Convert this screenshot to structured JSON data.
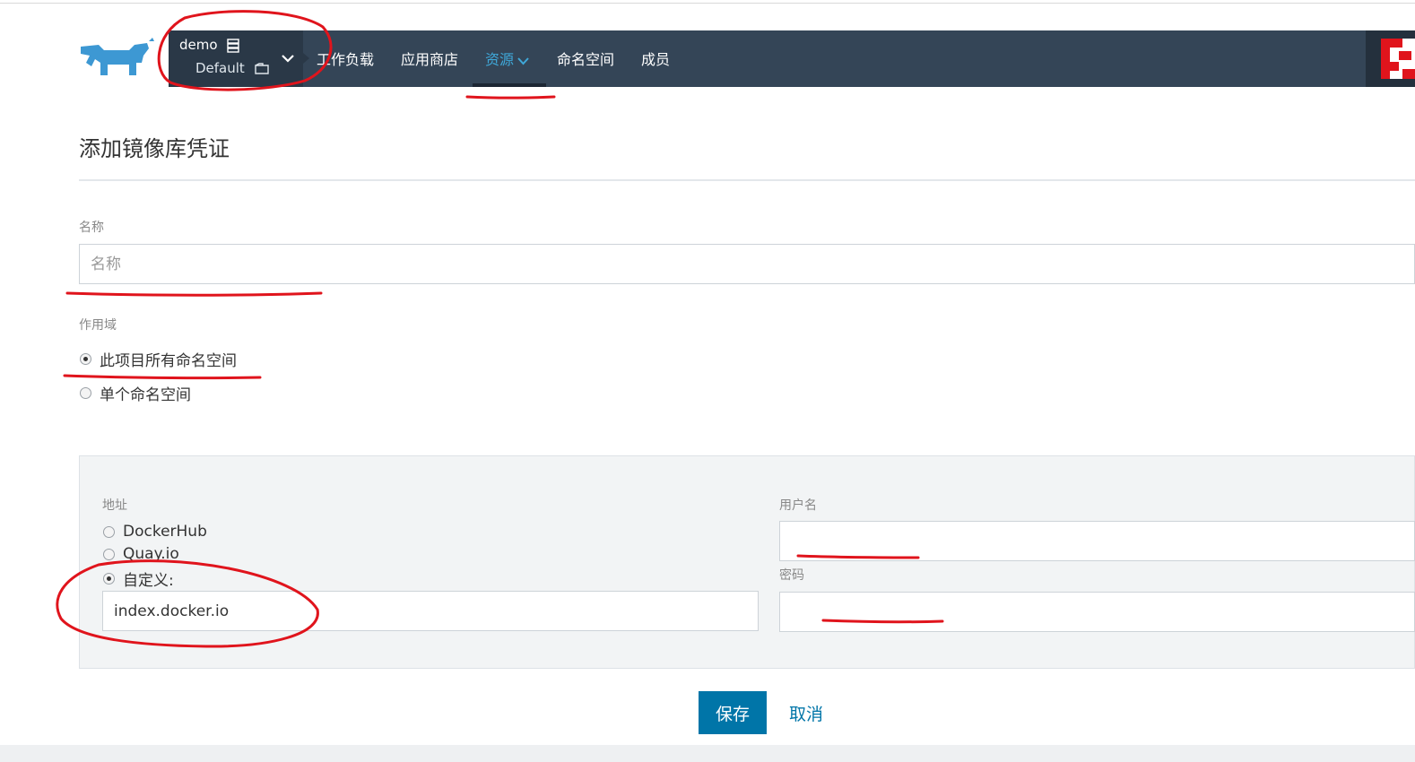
{
  "header": {
    "environment": {
      "cluster": "demo",
      "project": "Default"
    },
    "nav": [
      {
        "label": "工作负载",
        "active": false
      },
      {
        "label": "应用商店",
        "active": false
      },
      {
        "label": "资源",
        "active": true,
        "has_dropdown": true
      },
      {
        "label": "命名空间",
        "active": false
      },
      {
        "label": "成员",
        "active": false
      }
    ],
    "logo_icon": "rancher-cow-logo",
    "user_icon": "avatar-identicon"
  },
  "page": {
    "title": "添加镜像库凭证"
  },
  "form": {
    "name": {
      "label": "名称",
      "placeholder": "名称",
      "value": ""
    },
    "scope": {
      "label": "作用域",
      "options": [
        {
          "label": "此项目所有命名空间",
          "checked": true
        },
        {
          "label": "单个命名空间",
          "checked": false
        }
      ]
    },
    "registry": {
      "address_label": "地址",
      "address_options": [
        {
          "label": "DockerHub",
          "checked": false
        },
        {
          "label": "Quay.io",
          "checked": false
        },
        {
          "label": "自定义:",
          "checked": true
        }
      ],
      "custom_address_value": "index.docker.io",
      "username_label": "用户名",
      "username_value": "",
      "password_label": "密码",
      "password_value": ""
    }
  },
  "actions": {
    "save_label": "保存",
    "cancel_label": "取消"
  },
  "colors": {
    "navbar": "#344557",
    "nav_active": "#3fa8d9",
    "primary_button": "#0075a8",
    "annotation_red": "#e0141c"
  }
}
